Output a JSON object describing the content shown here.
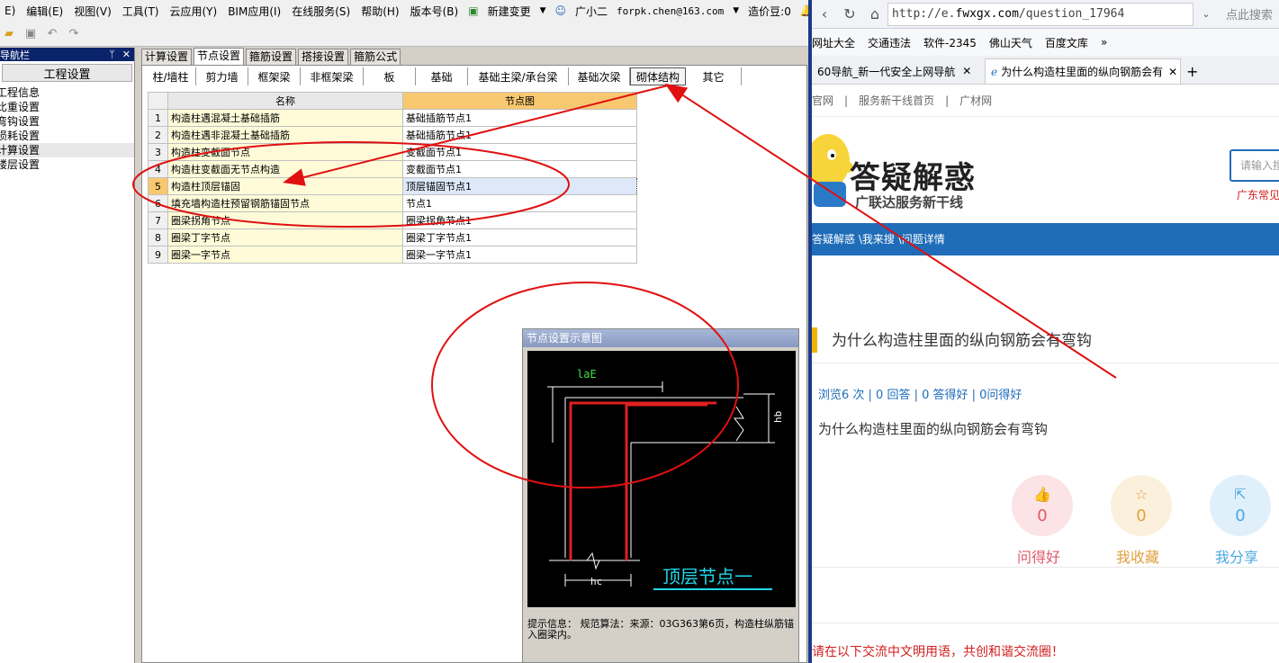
{
  "menubar": {
    "items": [
      "E)",
      "编辑(E)",
      "视图(V)",
      "工具(T)",
      "云应用(Y)",
      "BIM应用(I)",
      "在线服务(S)",
      "帮助(H)",
      "版本号(B)"
    ],
    "new_change": "新建变更",
    "assistant": "广小二",
    "user_email": "forpk.chen@163.com",
    "cost_beans": "造价豆:0"
  },
  "nav": {
    "header": "导航栏",
    "title": "工程设置",
    "items": [
      "工程信息",
      "比重设置",
      "弯钩设置",
      "损耗设置",
      "计算设置",
      "楼层设置"
    ],
    "selected_index": 4
  },
  "tabs_top": [
    "计算设置",
    "节点设置",
    "箍筋设置",
    "搭接设置",
    "箍筋公式"
  ],
  "tabs_top_active": 1,
  "tabs_sub": [
    "柱/墙柱",
    "剪力墙",
    "框架梁",
    "非框架梁",
    "板",
    "基础",
    "基础主梁/承台梁",
    "基础次梁",
    "砌体结构",
    "其它"
  ],
  "tabs_sub_active": 8,
  "grid": {
    "headers": [
      "名称",
      "节点图"
    ],
    "rows": [
      {
        "num": "1",
        "name": "构造柱遇混凝土基础插筋",
        "node": "基础插筋节点1"
      },
      {
        "num": "2",
        "name": "构造柱遇非混凝土基础插筋",
        "node": "基础插筋节点1"
      },
      {
        "num": "3",
        "name": "构造柱变截面节点",
        "node": "变截面节点1"
      },
      {
        "num": "4",
        "name": "构造柱变截面无节点构造",
        "node": "变截面节点1"
      },
      {
        "num": "5",
        "name": "构造柱顶层锚固",
        "node": "顶层锚固节点1"
      },
      {
        "num": "6",
        "name": "填充墙构造柱预留钢筋锚固节点",
        "node": "节点1"
      },
      {
        "num": "7",
        "name": "圈梁拐角节点",
        "node": "圈梁拐角节点1"
      },
      {
        "num": "8",
        "name": "圈梁丁字节点",
        "node": "圈梁丁字节点1"
      },
      {
        "num": "9",
        "name": "圈梁一字节点",
        "node": "圈梁一字节点1"
      }
    ],
    "selected_index": 4
  },
  "diagram": {
    "title": "节点设置示意图",
    "label_lae": "laE",
    "label_hb": "hb",
    "label_hc": "hc",
    "caption": "顶层节点一",
    "tip": "提示信息： 规范算法：来源：03G363第6页，构造柱纵筋锚入圈梁内。"
  },
  "browser": {
    "url_prefix": "http://e.",
    "url_domain": "fwxgx.com",
    "url_path": "/question_17964",
    "search_placeholder": "点此搜索",
    "favorites": [
      "网址大全",
      "交通违法",
      "软件-2345",
      "佛山天气",
      "百度文库"
    ],
    "tabs": [
      "60导航_新一代安全上网导航",
      "为什么构造柱里面的纵向钢筋会有"
    ],
    "site_nav": [
      "官网",
      "服务新干线首页",
      "广材网"
    ],
    "logo_title": "答疑解惑",
    "logo_sub": "广联达服务新干线",
    "search_input_placeholder": "请输入搜",
    "hot_text": "广东常见",
    "breadcrumb": "答疑解惑 \\我来搜 \\问题详情",
    "question_title": "为什么构造柱里面的纵向钢筋会有弯钩",
    "stats": "浏览6 次 | 0 回答 | 0 答得好 | 0问得好",
    "question_body": "为什么构造柱里面的纵向钢筋会有弯钩",
    "actions": [
      {
        "label": "问得好",
        "count": "0",
        "color": "#e05a6a",
        "bg": "#fbe3e6"
      },
      {
        "label": "我收藏",
        "count": "0",
        "color": "#e0a040",
        "bg": "#fbf0dc"
      },
      {
        "label": "我分享",
        "count": "0",
        "color": "#4aa8e0",
        "bg": "#e0f0fb"
      }
    ],
    "notice": "请在以下交流中文明用语，共创和谐交流圈！"
  },
  "colors": {
    "annotation_red": "#e01010",
    "brand_blue": "#1f6db8",
    "rebar_red": "#e02020",
    "caption_cyan": "#20d8e8"
  }
}
